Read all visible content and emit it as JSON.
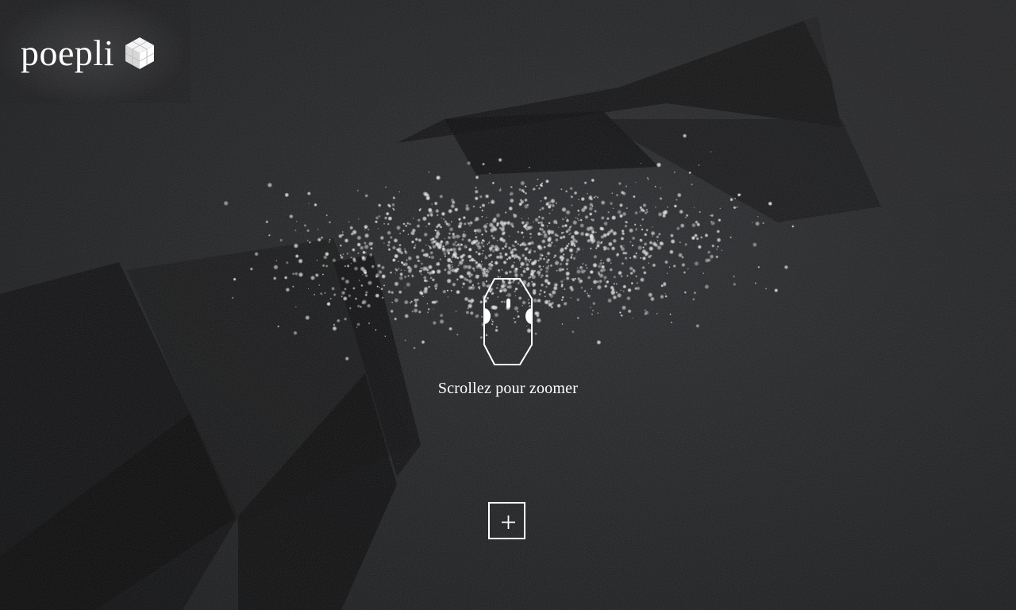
{
  "brand": {
    "name": "poepli",
    "logo_icon": "cube-logo-icon"
  },
  "hint": {
    "icon": "mouse-scroll-icon",
    "label": "Scrollez pour zoomer"
  },
  "actions": {
    "plus_icon": "plus-icon"
  },
  "colors": {
    "background": "#1e1f21",
    "foreground": "#ffffff",
    "particles": "#d8d8d8"
  }
}
